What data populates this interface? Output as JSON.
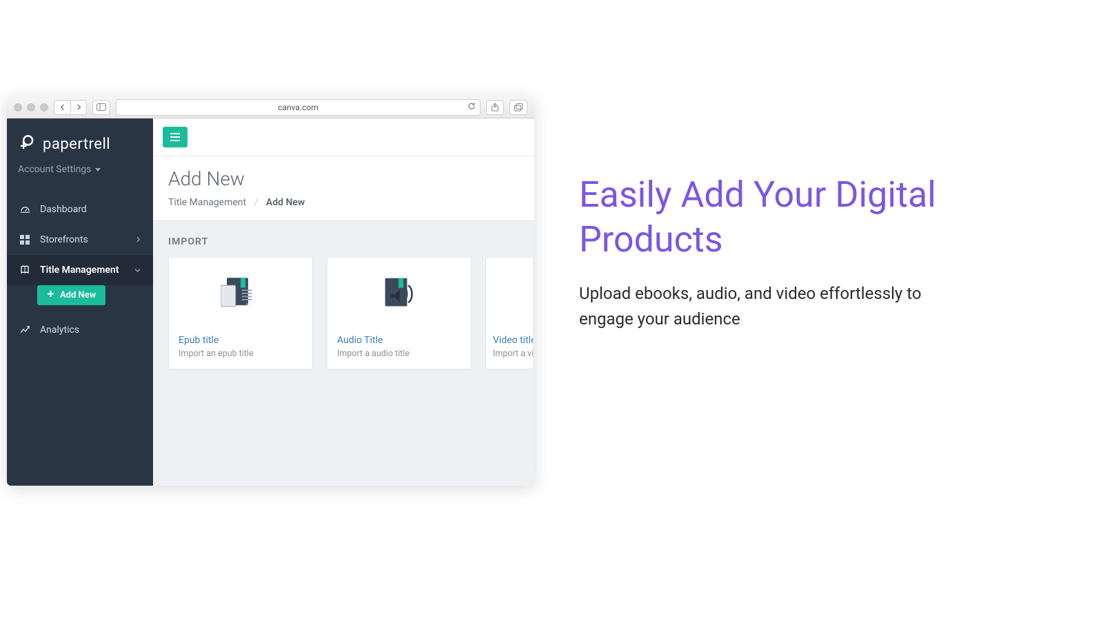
{
  "browser": {
    "address": "canva.com"
  },
  "brand": "papertrell",
  "account": {
    "label": "Account Settings"
  },
  "nav": {
    "dashboard": "Dashboard",
    "storefronts": "Storefronts",
    "title_mgmt": "Title Management",
    "add_new_btn": "Add New",
    "analytics": "Analytics"
  },
  "page": {
    "title": "Add New",
    "crumb_parent": "Title Management",
    "crumb_current": "Add New",
    "section": "IMPORT"
  },
  "cards": {
    "epub": {
      "title": "Epub title",
      "sub": "Import an epub title"
    },
    "audio": {
      "title": "Audio Title",
      "sub": "Import a audio title"
    },
    "video": {
      "title": "Video title",
      "sub": "Import a vi"
    }
  },
  "promo": {
    "headline": "Easily Add Your Digital Products",
    "body": "Upload ebooks, audio, and video effortlessly to engage your audience"
  }
}
